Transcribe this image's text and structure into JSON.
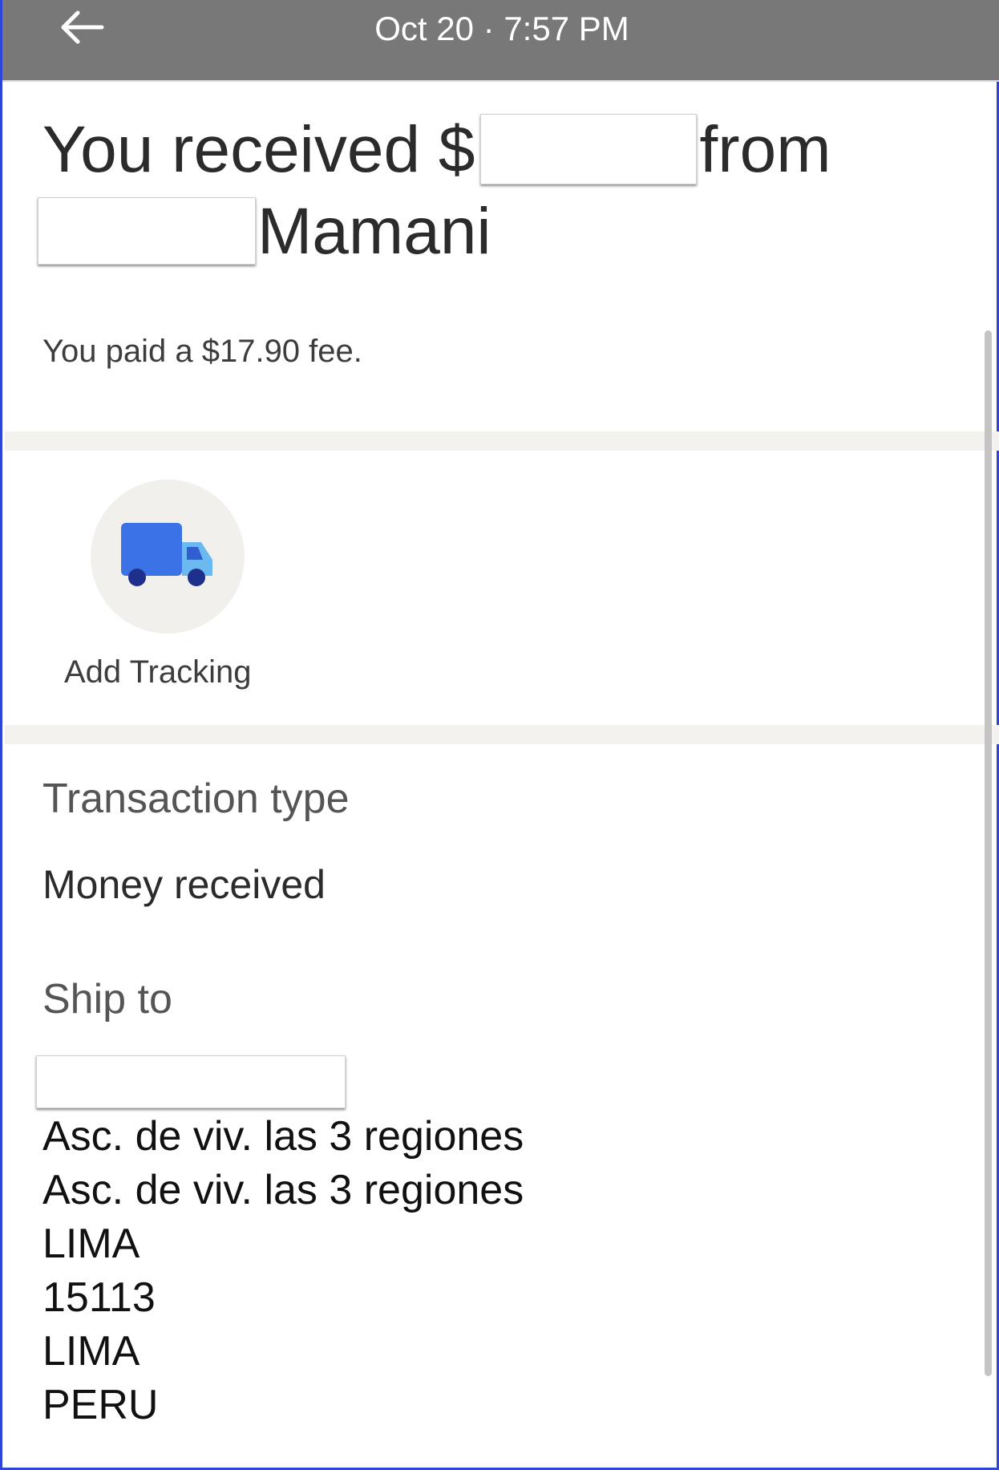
{
  "header": {
    "datetime": "Oct 20 · 7:57 PM",
    "back_icon": "arrow-left-icon"
  },
  "headline": {
    "prefix": "You received $",
    "from_word": "from",
    "surname": "Mamani"
  },
  "fee_text": "You paid a $17.90 fee.",
  "tracking": {
    "label": "Add Tracking",
    "icon": "delivery-truck-icon",
    "colors": {
      "body": "#3b72e6",
      "cab": "#6ab9f1",
      "wheels": "#1e2f8c"
    }
  },
  "transaction": {
    "label": "Transaction type",
    "value": "Money received"
  },
  "ship_to": {
    "label": "Ship to",
    "address_lines": [
      "Asc. de viv. las 3 regiones",
      "Asc. de viv. las 3 regiones",
      "LIMA",
      "15113",
      "LIMA",
      "PERU"
    ]
  }
}
